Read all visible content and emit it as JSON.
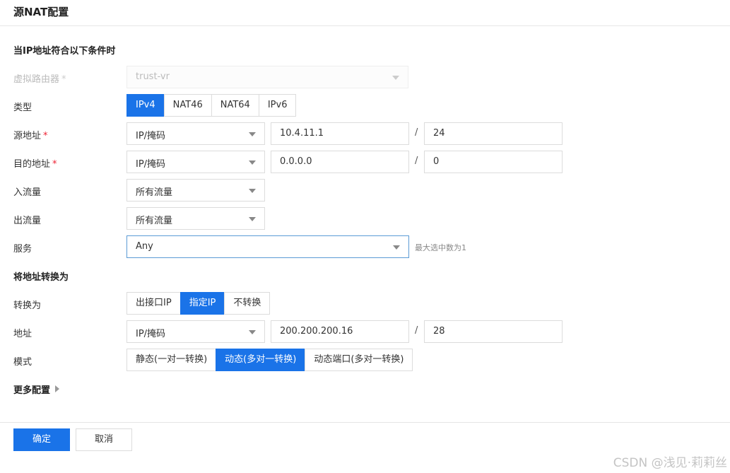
{
  "header": {
    "title": "源NAT配置"
  },
  "section_condition": {
    "title": "当IP地址符合以下条件时"
  },
  "virtual_router": {
    "label": "虚拟路由器",
    "value": "trust-vr"
  },
  "type": {
    "label": "类型",
    "options": [
      "IPv4",
      "NAT46",
      "NAT64",
      "IPv6"
    ],
    "selected": "IPv4"
  },
  "source": {
    "label": "源地址",
    "mode": "IP/掩码",
    "ip": "10.4.11.1",
    "mask": "24"
  },
  "destination": {
    "label": "目的地址",
    "mode": "IP/掩码",
    "ip": "0.0.0.0",
    "mask": "0"
  },
  "ingress": {
    "label": "入流量",
    "value": "所有流量"
  },
  "egress": {
    "label": "出流量",
    "value": "所有流量"
  },
  "service": {
    "label": "服务",
    "value": "Any",
    "hint": "最大选中数为1"
  },
  "section_translate": {
    "title": "将地址转换为"
  },
  "translate_to": {
    "label": "转换为",
    "options": [
      "出接口IP",
      "指定IP",
      "不转换"
    ],
    "selected": "指定IP"
  },
  "address": {
    "label": "地址",
    "mode": "IP/掩码",
    "ip": "200.200.200.16",
    "mask": "28"
  },
  "mode": {
    "label": "模式",
    "options": [
      "静态(一对一转换)",
      "动态(多对一转换)",
      "动态端口(多对一转换)"
    ],
    "selected": "动态(多对一转换)"
  },
  "more": {
    "label": "更多配置"
  },
  "footer": {
    "ok_label": "确定",
    "cancel_label": "取消"
  },
  "required_mark": "*",
  "slash": "/",
  "watermark": "CSDN @浅见·莉莉丝",
  "colors": {
    "accent": "#1a73e8",
    "required": "#ee2233"
  }
}
